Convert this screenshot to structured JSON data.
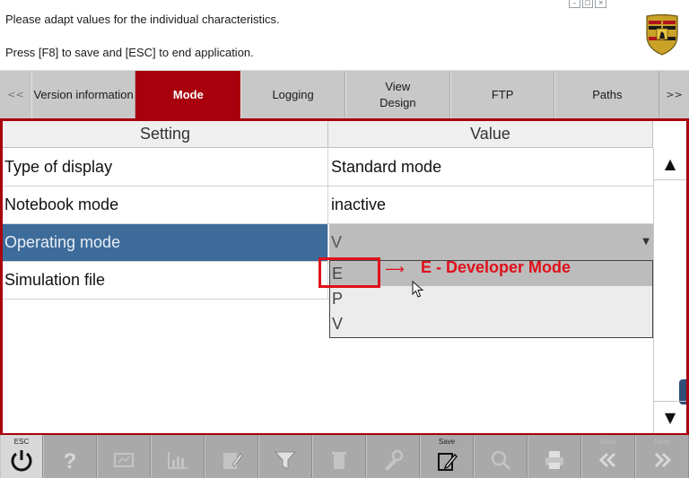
{
  "header": {
    "line1": "Please adapt values for the individual characteristics.",
    "line2": "Press [F8] to save and [ESC] to end application.",
    "logo": "porsche-crest"
  },
  "tabs": {
    "prev_arrow": "<<",
    "next_arrow": ">>",
    "items": [
      {
        "label": "Version information",
        "active": false
      },
      {
        "label": "Mode",
        "active": true
      },
      {
        "label": "Logging",
        "active": false
      },
      {
        "label": "View\nDesign",
        "active": false
      },
      {
        "label": "FTP",
        "active": false
      },
      {
        "label": "Paths",
        "active": false
      }
    ]
  },
  "table": {
    "headers": {
      "setting": "Setting",
      "value": "Value"
    },
    "rows": [
      {
        "setting": "Type of display",
        "value": "Standard mode"
      },
      {
        "setting": "Notebook mode",
        "value": "inactive"
      },
      {
        "setting": "Operating mode",
        "value": "V",
        "selected": true
      },
      {
        "setting": "Simulation file",
        "value": ""
      }
    ],
    "dropdown_options": [
      "E",
      "P",
      "V"
    ],
    "dropdown_highlighted": "E"
  },
  "annotation": {
    "arrow": "⟶",
    "text": "E - Developer Mode"
  },
  "toolbar": {
    "buttons": [
      {
        "icon": "power-icon",
        "label": "ESC",
        "dim": false
      },
      {
        "icon": "help-icon",
        "label": "",
        "dim": false
      },
      {
        "icon": "screen-icon",
        "label": "",
        "dim": false
      },
      {
        "icon": "chart-icon",
        "label": "",
        "dim": false
      },
      {
        "icon": "edit-note-icon",
        "label": "",
        "dim": false
      },
      {
        "icon": "filter-icon",
        "label": "",
        "dim": false
      },
      {
        "icon": "trash-icon",
        "label": "",
        "dim": false
      },
      {
        "icon": "tools-icon",
        "label": "",
        "dim": false
      },
      {
        "icon": "save-icon",
        "label": "Save",
        "dim": false
      },
      {
        "icon": "search-icon",
        "label": "",
        "dim": false
      },
      {
        "icon": "print-icon",
        "label": "",
        "dim": false
      },
      {
        "icon": "back-icon",
        "label": "Back",
        "dim": true
      },
      {
        "icon": "next-icon",
        "label": "Next",
        "dim": true
      }
    ]
  },
  "colors": {
    "accent": "#a8000c",
    "selection": "#3d6c9a",
    "annotation": "#e0101a"
  }
}
